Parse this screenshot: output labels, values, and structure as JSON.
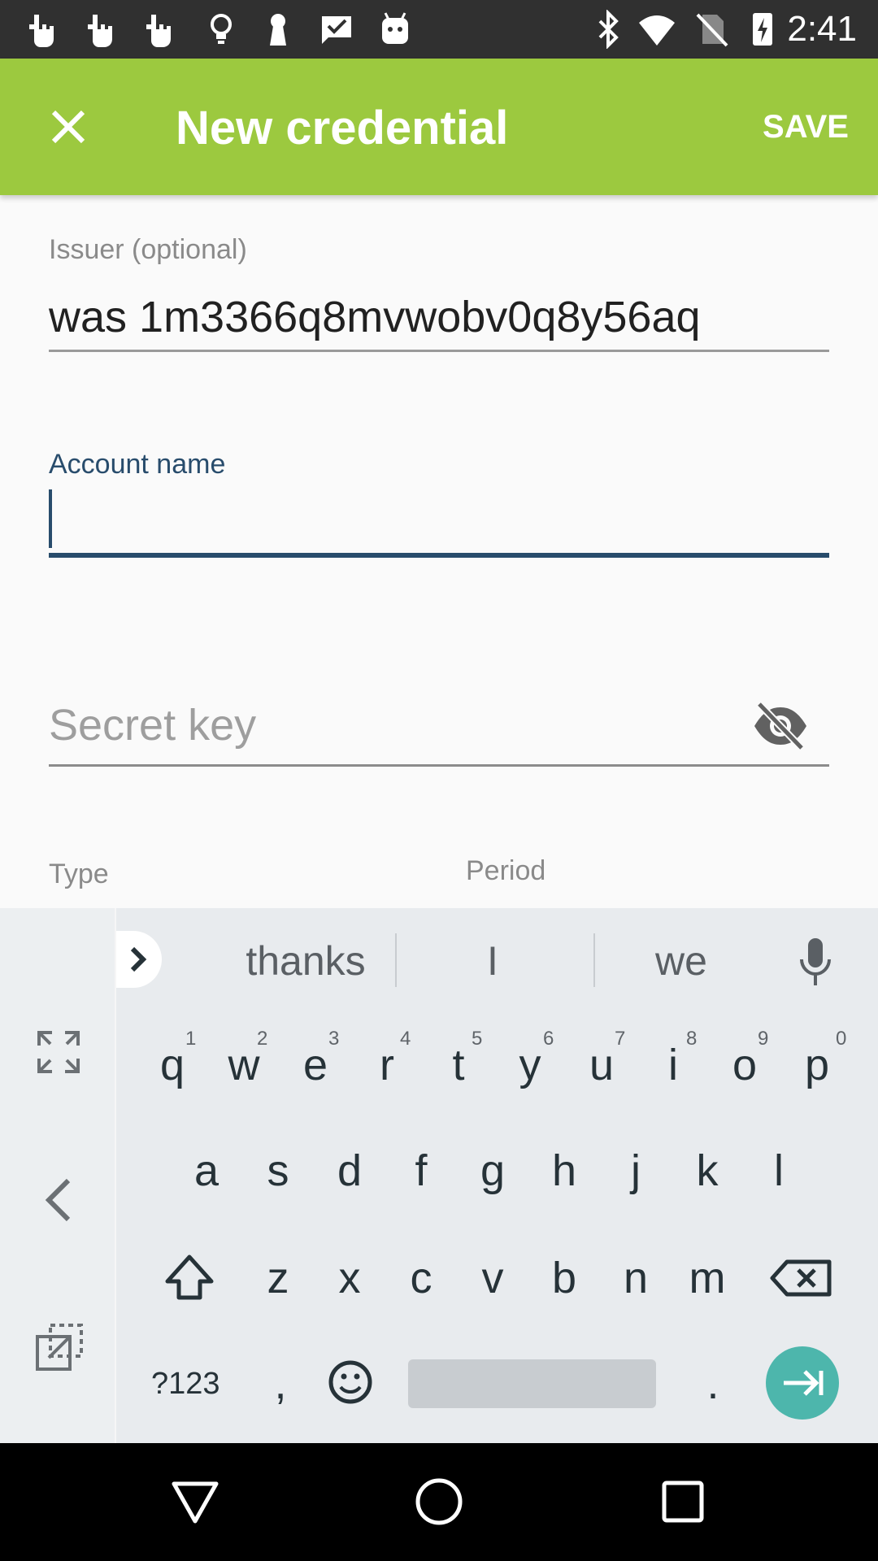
{
  "status_bar": {
    "time": "2:41",
    "left_icons": [
      "hand-pointer-icon",
      "hand-pointer-icon",
      "hand-pointer-icon",
      "lightbulb-icon",
      "keyhole-icon",
      "checkmark-flag-icon",
      "android-icon"
    ],
    "right_icons": [
      "bluetooth-icon",
      "wifi-icon",
      "no-sim-icon",
      "battery-charging-icon"
    ]
  },
  "toolbar": {
    "title": "New credential",
    "save_label": "SAVE",
    "color": "#9cc93f"
  },
  "form": {
    "issuer": {
      "label": "Issuer (optional)",
      "value": "was 1m3366q8mvwobv0q8y56aq"
    },
    "account": {
      "label": "Account name",
      "value": ""
    },
    "secret": {
      "placeholder": "Secret key"
    },
    "type_label": "Type",
    "period_label": "Period",
    "accent": "#284c6c"
  },
  "keyboard": {
    "suggestions": [
      "thanks",
      "I",
      "we"
    ],
    "row1": [
      "q",
      "w",
      "e",
      "r",
      "t",
      "y",
      "u",
      "i",
      "o",
      "p"
    ],
    "row1_hints": [
      "1",
      "2",
      "3",
      "4",
      "5",
      "6",
      "7",
      "8",
      "9",
      "0"
    ],
    "row2": [
      "a",
      "s",
      "d",
      "f",
      "g",
      "h",
      "j",
      "k",
      "l"
    ],
    "row3": [
      "z",
      "x",
      "c",
      "v",
      "b",
      "n",
      "m"
    ],
    "symbols_label": "?123",
    "comma": ",",
    "period": ".",
    "enter_color": "#4db6ac"
  }
}
